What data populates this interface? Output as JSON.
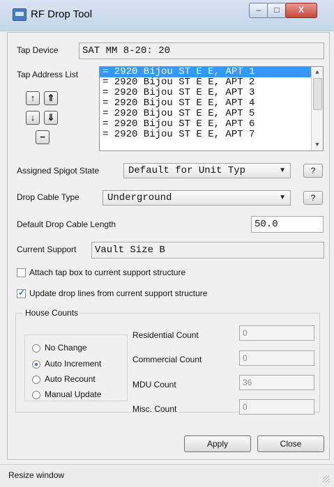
{
  "window": {
    "title": "RF Drop Tool",
    "buttons": {
      "minimize": "–",
      "maximize": "□",
      "close": "X"
    }
  },
  "tap_device": {
    "label": "Tap Device",
    "value": "SAT MM 8-20: 20"
  },
  "tap_address_list": {
    "label": "Tap Address List",
    "items": [
      "= 2920 Bijou ST E E, APT 1",
      "= 2920 Bijou ST E E, APT 2",
      "= 2920 Bijou ST E E, APT 3",
      "= 2920 Bijou ST E E, APT 4",
      "= 2920 Bijou ST E E, APT 5",
      "= 2920 Bijou ST E E, APT 6",
      "= 2920 Bijou ST E E, APT 7"
    ],
    "selected_index": 0
  },
  "assigned_spigot_state": {
    "label": "Assigned Spigot State",
    "value": "Default for Unit Typ",
    "help_label": "?"
  },
  "drop_cable_type": {
    "label": "Drop Cable Type",
    "value": "Underground",
    "help_label": "?"
  },
  "default_drop_cable_length": {
    "label": "Default Drop Cable Length",
    "value": "50.0"
  },
  "current_support": {
    "label": "Current Support",
    "value": "Vault Size B"
  },
  "options": {
    "attach_tap_box": {
      "label": "Attach tap box to current support structure",
      "checked": false
    },
    "update_drop_lines": {
      "label": "Update drop lines from current support structure",
      "checked": true
    }
  },
  "house_counts": {
    "title": "House Counts",
    "modes": [
      {
        "label": "No Change",
        "selected": false
      },
      {
        "label": "Auto Increment",
        "selected": true
      },
      {
        "label": "Auto Recount",
        "selected": false
      },
      {
        "label": "Manual Update",
        "selected": false
      }
    ],
    "residential_count": {
      "label": "Residential Count",
      "value": "0"
    },
    "commercial_count": {
      "label": "Commercial Count",
      "value": "0"
    },
    "mdu_count": {
      "label": "MDU Count",
      "value": "36"
    },
    "misc_count": {
      "label": "Misc. Count",
      "value": "0"
    }
  },
  "footer": {
    "apply_label": "Apply",
    "close_label": "Close"
  },
  "status": {
    "text": "Resize window"
  }
}
